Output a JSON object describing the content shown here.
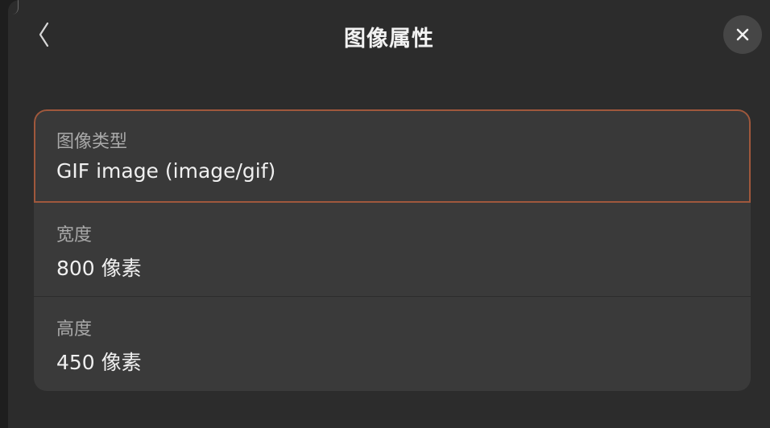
{
  "dialog": {
    "title": "图像属性",
    "back_icon": "chevron-left-icon",
    "close_icon": "close-icon"
  },
  "properties": [
    {
      "label": "图像类型",
      "value": "GIF image (image/gif)"
    },
    {
      "label": "宽度",
      "value": "800 像素"
    },
    {
      "label": "高度",
      "value": "450 像素"
    }
  ],
  "colors": {
    "dialog_bg": "#2c2c2c",
    "list_bg": "#3a3a3a",
    "focus_border": "#a0583c"
  }
}
